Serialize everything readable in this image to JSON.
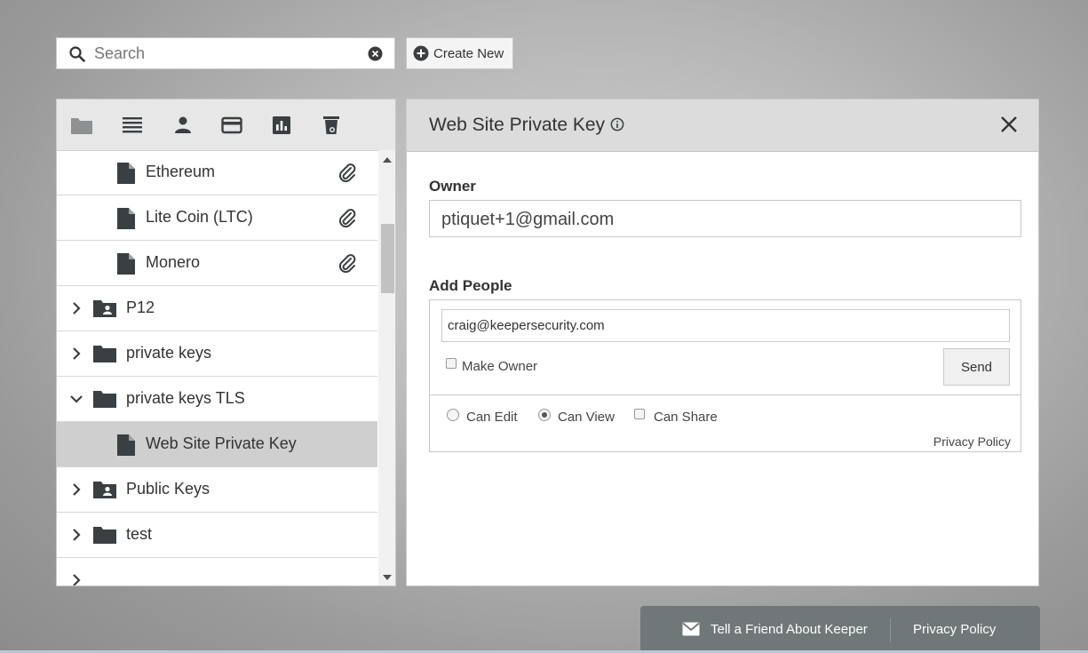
{
  "search": {
    "placeholder": "Search"
  },
  "create_new": {
    "label": "Create New"
  },
  "toolbar": {
    "icons": [
      "folder-icon",
      "list-icon",
      "person-icon",
      "credit-card-icon",
      "bar-chart-icon",
      "trash-icon"
    ]
  },
  "tree": {
    "items": [
      {
        "label": "Ethereum",
        "type": "record",
        "attachment": true
      },
      {
        "label": "Lite Coin (LTC)",
        "type": "record",
        "attachment": true
      },
      {
        "label": "Monero",
        "type": "record",
        "attachment": true
      },
      {
        "label": "P12",
        "type": "shared-folder",
        "expanded": false
      },
      {
        "label": "private keys",
        "type": "folder",
        "expanded": false
      },
      {
        "label": "private keys TLS",
        "type": "folder",
        "expanded": true
      },
      {
        "label": "Web Site Private Key",
        "type": "record",
        "selected": true
      },
      {
        "label": "Public Keys",
        "type": "shared-folder",
        "expanded": false
      },
      {
        "label": "test",
        "type": "folder",
        "expanded": false
      }
    ]
  },
  "panel": {
    "title": "Web Site Private Key",
    "owner_label": "Owner",
    "owner_value": "ptiquet+1@gmail.com",
    "add_people_label": "Add People",
    "email_value": "craig@keepersecurity.com",
    "make_owner_label": "Make Owner",
    "make_owner_checked": false,
    "send_label": "Send",
    "permissions": {
      "can_edit": "Can Edit",
      "can_view": "Can View",
      "can_share": "Can Share",
      "selected": "can_view",
      "can_share_checked": false
    },
    "privacy_policy": "Privacy Policy"
  },
  "footer": {
    "tell_friend": "Tell a Friend About Keeper",
    "privacy_policy": "Privacy Policy"
  },
  "colors": {
    "icon_dark": "#3a3f42",
    "selected_row": "#cfcfcf",
    "header_bg": "#dcdcdc",
    "footer_bg": "#6f7778"
  }
}
